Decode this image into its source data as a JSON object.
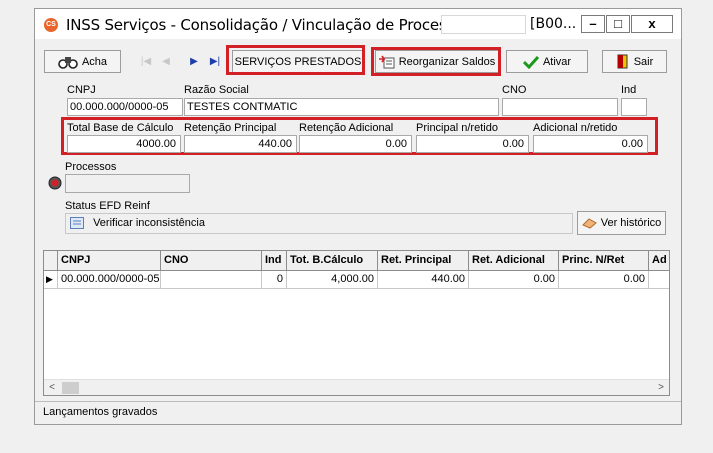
{
  "window": {
    "title": "INSS Serviços - Consolidação / Vinculação de Processo|",
    "title_suffix": "[B00...",
    "controls": {
      "minimize": "–",
      "maximize": "□",
      "close": "x"
    }
  },
  "toolbar": {
    "find_label": "Acha",
    "services_label": "SERVIÇOS PRESTADOS",
    "reorganize_label": "Reorganizar Saldos",
    "activate_label": "Ativar",
    "exit_label": "Sair"
  },
  "form": {
    "cnpj_label": "CNPJ",
    "cnpj_value": "00.000.000/0000-05",
    "razao_label": "Razão Social",
    "razao_value": "TESTES CONTMATIC",
    "cno_label": "CNO",
    "cno_value": "",
    "ind_label": "Ind",
    "ind_value": "",
    "total_base_label": "Total Base de Cálculo",
    "total_base_value": "4000.00",
    "ret_principal_label": "Retenção Principal",
    "ret_principal_value": "440.00",
    "ret_adicional_label": "Retenção Adicional",
    "ret_adicional_value": "0.00",
    "principal_nretido_label": "Principal n/retido",
    "principal_nretido_value": "0.00",
    "adicional_nretido_label": "Adicional n/retido",
    "adicional_nretido_value": "0.00",
    "processos_label": "Processos",
    "processos_value": "",
    "status_label": "Status EFD Reinf",
    "status_value": "Verificar inconsistência",
    "history_label": "Ver histórico"
  },
  "grid": {
    "columns": [
      "CNPJ",
      "CNO",
      "Ind",
      "Tot. B.Cálculo",
      "Ret. Principal",
      "Ret. Adicional",
      "Princ. N/Ret",
      "Ad"
    ],
    "rows": [
      [
        "00.000.000/0000-05",
        "",
        "0",
        "4,000.00",
        "440.00",
        "0.00",
        "0.00",
        ""
      ]
    ],
    "row_marker": "▶"
  },
  "statusbar": {
    "text": "Lançamentos gravados"
  },
  "colors": {
    "highlight": "#d32027",
    "app_icon": "#e8652c",
    "nav_blue": "#1f3fa8"
  },
  "icons": [
    "binoculars-icon",
    "first-record-icon",
    "prev-record-icon",
    "next-record-icon",
    "last-record-icon",
    "reorganize-icon",
    "checkmark-icon",
    "exit-door-icon",
    "record-icon",
    "list-icon",
    "eraser-icon",
    "scroll-left-icon",
    "scroll-right-icon"
  ]
}
